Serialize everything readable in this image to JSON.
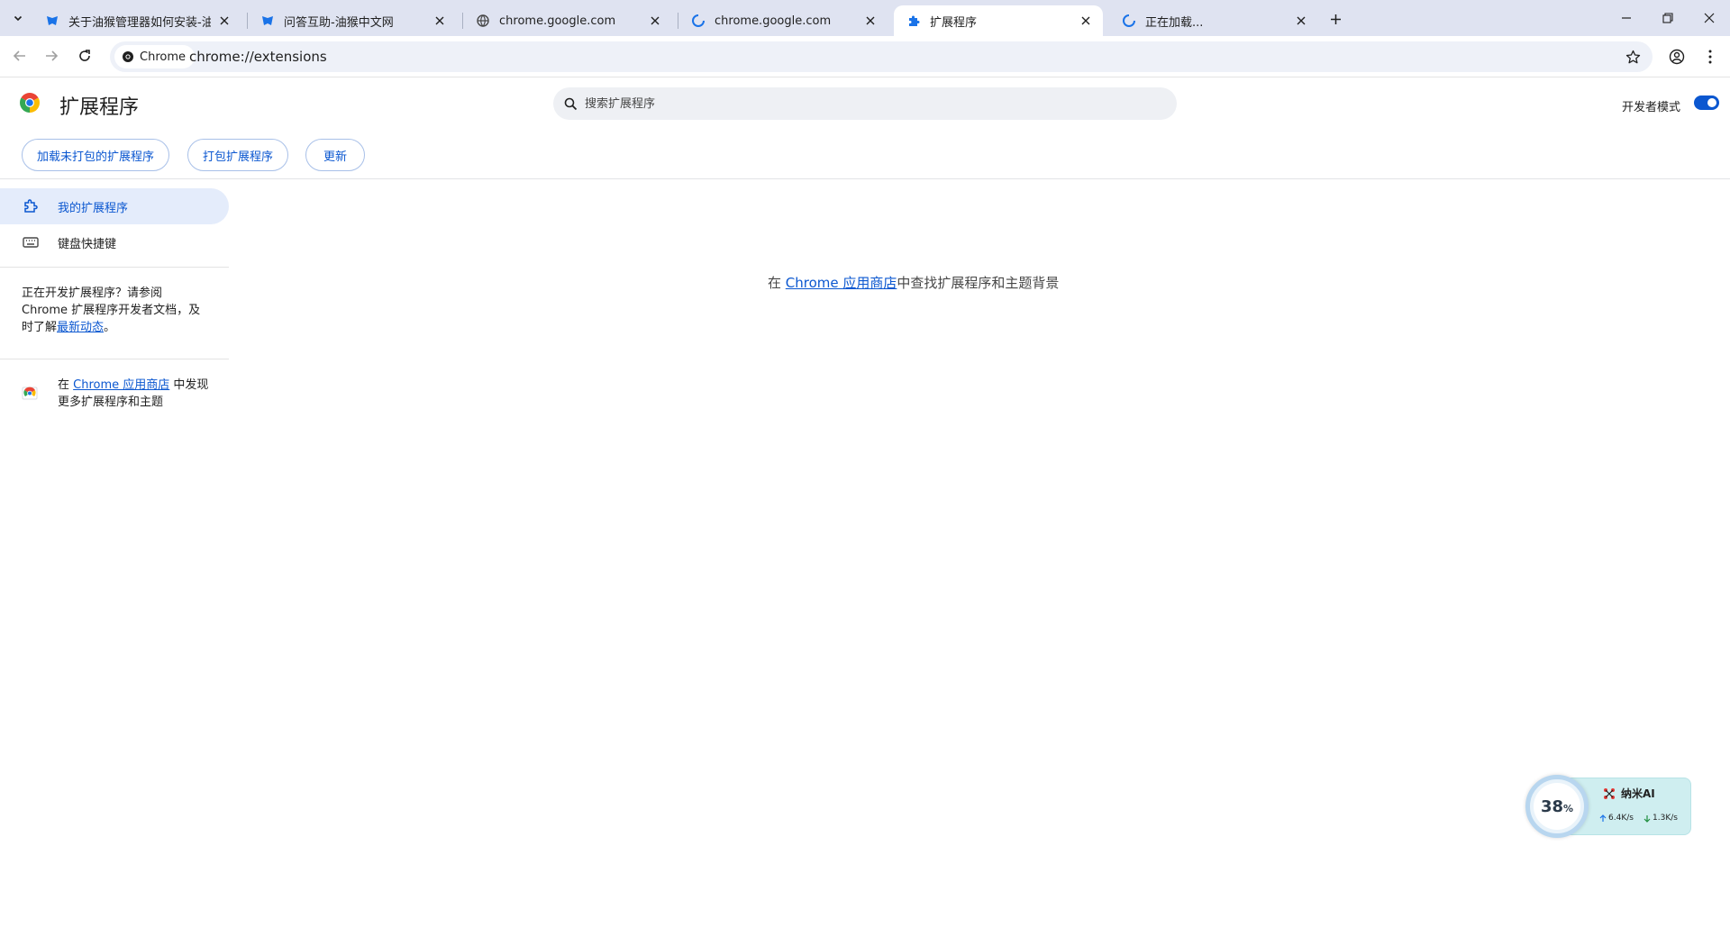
{
  "tabs": [
    {
      "title": "关于油猴管理器如何安装-油猴中",
      "favicon": "tampermonkey-icon",
      "active": false
    },
    {
      "title": "问答互助-油猴中文网",
      "favicon": "tampermonkey-icon",
      "active": false
    },
    {
      "title": "chrome.google.com",
      "favicon": "globe-icon",
      "active": false
    },
    {
      "title": "chrome.google.com",
      "favicon": "loading-spinner-icon",
      "active": false
    },
    {
      "title": "扩展程序",
      "favicon": "puzzle-icon",
      "active": true
    },
    {
      "title": "正在加载...",
      "favicon": "loading-spinner-icon",
      "active": false
    }
  ],
  "omnibox": {
    "chip_label": "Chrome",
    "url": "chrome://extensions"
  },
  "header": {
    "title": "扩展程序",
    "search_placeholder": "搜索扩展程序",
    "dev_mode_label": "开发者模式",
    "dev_mode_on": true
  },
  "actions": {
    "load_unpacked": "加载未打包的扩展程序",
    "pack": "打包扩展程序",
    "update": "更新"
  },
  "sidebar": {
    "items": [
      {
        "label": "我的扩展程序",
        "icon": "extensions-icon"
      },
      {
        "label": "键盘快捷键",
        "icon": "keyboard-icon"
      }
    ],
    "dev_text_1": "正在开发扩展程序？请参阅 Chrome 扩展程序开发者文档，及时了解",
    "dev_link": "最新动态",
    "dev_text_2": "。",
    "webstore_prefix": "在 ",
    "webstore_link": "Chrome 应用商店",
    "webstore_suffix": " 中发现更多扩展程序和主题"
  },
  "main": {
    "prefix": "在 ",
    "link": "Chrome 应用商店",
    "suffix": "中查找扩展程序和主题背景"
  },
  "widget": {
    "percent": "38",
    "percent_unit": "%",
    "brand": "纳米AI",
    "upload": "6.4K/s",
    "download": "1.3K/s"
  },
  "colors": {
    "accent": "#0b57d0",
    "tabstrip": "#dfe3f1",
    "active_nav_bg": "#e4ecfb"
  }
}
